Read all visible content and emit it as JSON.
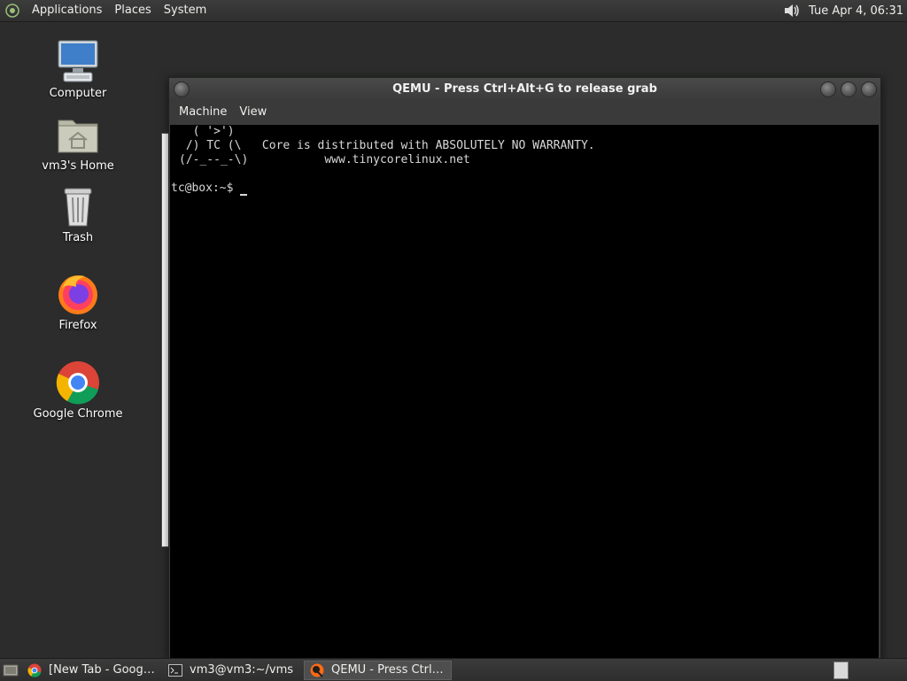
{
  "top_panel": {
    "menus": [
      "Applications",
      "Places",
      "System"
    ],
    "clock": "Tue Apr  4, 06:31",
    "icons": {
      "distro": "gnome-foot-icon",
      "volume": "speaker-icon"
    }
  },
  "desktop": {
    "icons": [
      {
        "label": "Computer",
        "icon": "computer-icon"
      },
      {
        "label": "vm3's Home",
        "icon": "home-folder-icon"
      },
      {
        "label": "Trash",
        "icon": "trash-icon"
      },
      {
        "label": "Firefox",
        "icon": "firefox-icon"
      },
      {
        "label": "Google Chrome",
        "icon": "chrome-icon"
      }
    ]
  },
  "qemu_window": {
    "title": "QEMU - Press Ctrl+Alt+G to release grab",
    "menu": [
      "Machine",
      "View"
    ],
    "console_lines": [
      "  ( '>')",
      " /) TC (\\   Core is distributed with ABSOLUTELY NO WARRANTY.",
      "(/-_--_-\\)           www.tinycorelinux.net",
      "",
      "tc@box:~$ "
    ]
  },
  "bottom_panel": {
    "tasks": [
      {
        "label": "[New Tab - Google ...",
        "icon": "chrome-icon",
        "active": false
      },
      {
        "label": "vm3@vm3:~/vms",
        "icon": "terminal-icon",
        "active": false
      },
      {
        "label": "QEMU - Press Ctrl+...",
        "icon": "qemu-icon",
        "active": true
      }
    ],
    "icons": {
      "show_desktop": "show-desktop-icon",
      "workspace": "workspace-switcher"
    }
  },
  "colors": {
    "desktop_bg": "#2b2c2b",
    "console_bg": "#000000",
    "console_fg": "#d8d8d8",
    "panel_bg": "#333433"
  }
}
